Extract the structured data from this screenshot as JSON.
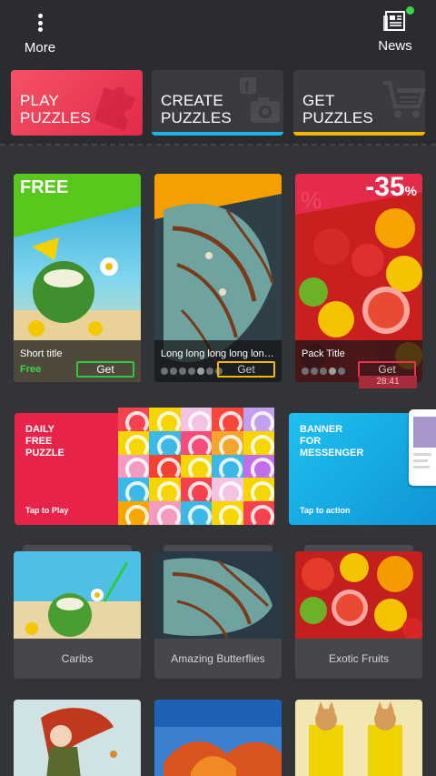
{
  "topbar": {
    "more_label": "More",
    "news_label": "News"
  },
  "tabs": [
    {
      "label_line1": "PLAY",
      "label_line2": "PUZZLES"
    },
    {
      "label_line1": "CREATE",
      "label_line2": "PUZZLES"
    },
    {
      "label_line1": "GET",
      "label_line2": "PUZZLES"
    }
  ],
  "featured": [
    {
      "ribbon": "FREE",
      "title": "Short title",
      "price": "Free",
      "button": "Get"
    },
    {
      "title": "Long long long long long lo...",
      "button": "Get"
    },
    {
      "sale": "-35",
      "sale_unit": "%",
      "title": "Pack Title",
      "button": "Get",
      "timer": "28:41"
    }
  ],
  "banners": {
    "daily": {
      "title_line1": "DAILY",
      "title_line2": "FREE",
      "title_line3": "PUZZLE",
      "cta": "Tap to Play"
    },
    "messenger": {
      "title_line1": "BANNER",
      "title_line2": "FOR",
      "title_line3": "MESSENGER",
      "cta": "Tap to action"
    }
  },
  "packs": [
    {
      "name": "Caribs"
    },
    {
      "name": "Amazing Butterflies"
    },
    {
      "name": "Exotic Fruits"
    },
    {
      "name": ""
    },
    {
      "name": ""
    },
    {
      "name": ""
    }
  ],
  "colors": {
    "accent_red": "#e8234a",
    "accent_blue": "#1bb5ea",
    "accent_yellow": "#f5b800",
    "accent_green": "#2ec944",
    "background": "#333438"
  }
}
